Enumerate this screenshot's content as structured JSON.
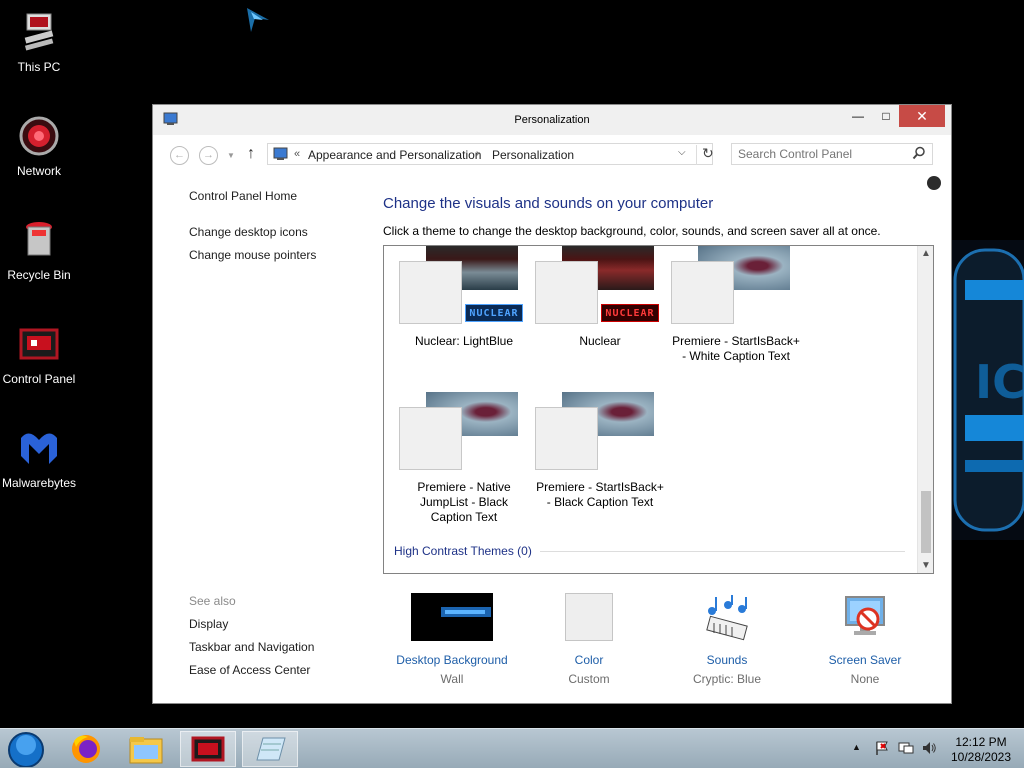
{
  "desktop": {
    "icons": [
      {
        "label": "This PC"
      },
      {
        "label": "Network"
      },
      {
        "label": "Recycle Bin"
      },
      {
        "label": "Control Panel"
      },
      {
        "label": "Malwarebytes"
      }
    ]
  },
  "window": {
    "title": "Personalization",
    "address": {
      "prefix": "«",
      "crumb1": "Appearance and Personalization",
      "separator": "›",
      "crumb2": "Personalization"
    },
    "search_placeholder": "Search Control Panel",
    "left_nav": {
      "home": "Control Panel Home",
      "desktop_icons": "Change desktop icons",
      "mouse_pointers": "Change mouse pointers",
      "see_also": "See also",
      "display": "Display",
      "taskbar": "Taskbar and Navigation",
      "ease": "Ease of Access Center"
    },
    "heading": "Change the visuals and sounds on your computer",
    "subtext": "Click a theme to change the desktop background, color, sounds, and screen saver all at once.",
    "themes": [
      {
        "name": "Nuclear: LightBlue",
        "badge": "NUCLEAR"
      },
      {
        "name": "Nuclear",
        "badge": "NUCLEAR"
      },
      {
        "name": "Premiere - StartIsBack+ - White Caption Text"
      },
      {
        "name": "Premiere - Native JumpList - Black Caption Text"
      },
      {
        "name": "Premiere - StartIsBack+ - Black Caption Text"
      }
    ],
    "high_contrast": "High Contrast Themes (0)",
    "bottom": [
      {
        "label": "Desktop Background",
        "sub": "Wall"
      },
      {
        "label": "Color",
        "sub": "Custom"
      },
      {
        "label": "Sounds",
        "sub": "Cryptic: Blue"
      },
      {
        "label": "Screen Saver",
        "sub": "None"
      }
    ]
  },
  "taskbar": {
    "time": "12:12 PM",
    "date": "10/28/2023"
  },
  "colors": {
    "close_button": "#c74b46",
    "heading": "#1e3287",
    "link": "#1e5ea8"
  }
}
